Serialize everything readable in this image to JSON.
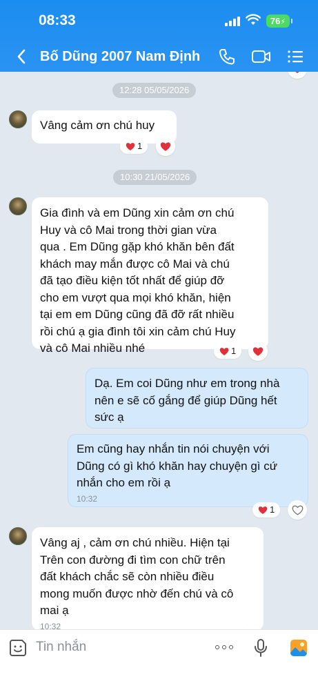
{
  "status": {
    "time": "08:33",
    "battery": "76"
  },
  "header": {
    "title": "Bố Dũng 2007 Nam Định"
  },
  "chat": {
    "time_chip_1": "12:28 05/05/2026",
    "time_chip_2": "10:30 21/05/2026",
    "msg1": {
      "text": "Vâng  cảm ơn chú huy",
      "reaction_count": "1"
    },
    "msg2": {
      "lines": [
        "Gia đình và em Dũng xin cảm ơn chú",
        "Huy và cô Mai trong thời gian vừa",
        "qua . Em Dũng gặp khó khăn bên đất",
        "khách may mắn được  cô Mai và chú",
        "đã tạo điều kiện tốt nhất để giúp đỡ",
        "cho em vượt qua mọi khó khăn, hiện",
        "tại em em Dũng cũng đã đỡ rất nhiều",
        "rồi chú ạ gia đình tôi xin cảm chú Huy",
        "và cô Mai nhiều nhé"
      ],
      "reaction_count": "1"
    },
    "msg3": {
      "lines": [
        "Dạ. Em coi Dũng như em trong nhà",
        "nên e sẽ cố gắng để giúp Dũng hết",
        "sức ạ"
      ]
    },
    "msg4": {
      "lines": [
        "Em cũng hay nhắn tin nói chuyện với",
        "Dũng có gì khó khăn hay chuyện gì cứ",
        "nhắn cho em rồi ạ"
      ],
      "time": "10:32",
      "reaction_count": "1"
    },
    "msg5": {
      "lines": [
        "Vâng aj , cảm ơn chú nhiều. Hiện tại",
        "Trên con đường đi tìm  con chữ trên",
        "đất khách chắc sẽ còn nhiều điều",
        "mong muốn được nhờ đến chú và cô",
        "mai ạ"
      ],
      "time": "10:32"
    }
  },
  "input": {
    "placeholder": "Tin nhắn"
  },
  "colors": {
    "header": "#1b8df0",
    "heart": "#e0303a",
    "out_bubble": "#d4e9fb",
    "battery": "#4cd964"
  }
}
